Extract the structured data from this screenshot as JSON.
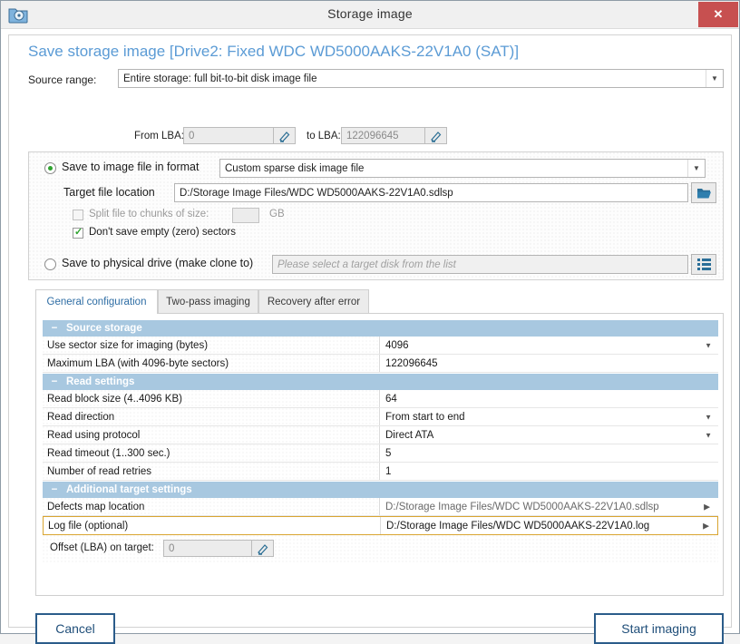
{
  "window": {
    "title": "Storage image",
    "icon": "storage-folder-icon",
    "close_label": "✕"
  },
  "page_title": "Save storage image [Drive2: Fixed WDC WD5000AAKS-22V1A0 (SAT)]",
  "source_range": {
    "label": "Source range:",
    "value": "Entire storage: full bit-to-bit disk image file",
    "from_lba_label": "From LBA:",
    "from_lba_value": "0",
    "to_lba_label": "to LBA:",
    "to_lba_value": "122096645",
    "edit_icon": "pencil-icon"
  },
  "save_options": {
    "image_file": {
      "radio_label": "Save to image file in format",
      "selected": true,
      "format_value": "Custom sparse disk image file",
      "target_label": "Target file location",
      "target_value": "D:/Storage Image Files/WDC WD5000AAKS-22V1A0.sdlsp",
      "browse_icon": "folder-open-icon",
      "split_label": "Split file to chunks of size:",
      "split_checked": false,
      "split_value": "",
      "split_unit": "GB",
      "no_empty_label": "Don't save empty (zero) sectors",
      "no_empty_checked": true
    },
    "physical_drive": {
      "radio_label": "Save to physical drive (make clone to)",
      "selected": false,
      "placeholder": "Please select a target disk from the list",
      "list_icon": "list-icon"
    }
  },
  "tabs": [
    {
      "label": "General configuration",
      "active": true
    },
    {
      "label": "Two-pass imaging",
      "active": false
    },
    {
      "label": "Recovery after error",
      "active": false
    }
  ],
  "sections": [
    {
      "title": "Source storage",
      "collapse_glyph": "−",
      "rows": [
        {
          "key": "Use sector size for imaging (bytes)",
          "value": "4096",
          "dropdown": true,
          "muted": false,
          "selected": false
        },
        {
          "key": "Maximum LBA (with 4096-byte sectors)",
          "value": "122096645",
          "dropdown": false,
          "muted": false,
          "selected": false
        }
      ]
    },
    {
      "title": "Read settings",
      "collapse_glyph": "−",
      "rows": [
        {
          "key": "Read block size (4..4096 KB)",
          "value": "64",
          "dropdown": false,
          "muted": false,
          "selected": false
        },
        {
          "key": "Read direction",
          "value": "From start to end",
          "dropdown": true,
          "muted": false,
          "selected": false
        },
        {
          "key": "Read using protocol",
          "value": "Direct ATA",
          "dropdown": true,
          "muted": false,
          "selected": false
        },
        {
          "key": "Read timeout (1..300 sec.)",
          "value": "5",
          "dropdown": false,
          "muted": false,
          "selected": false
        },
        {
          "key": "Number of read retries",
          "value": "1",
          "dropdown": false,
          "muted": false,
          "selected": false
        }
      ]
    },
    {
      "title": "Additional target settings",
      "collapse_glyph": "−",
      "rows": [
        {
          "key": "Defects map location",
          "value": "D:/Storage Image Files/WDC WD5000AAKS-22V1A0.sdlsp",
          "expand": true,
          "muted": true,
          "selected": false
        },
        {
          "key": "Log file (optional)",
          "value": "D:/Storage Image Files/WDC WD5000AAKS-22V1A0.log",
          "expand": true,
          "muted": false,
          "selected": true
        }
      ]
    }
  ],
  "offset": {
    "label": "Offset (LBA) on target:",
    "value": "0",
    "edit_icon": "pencil-icon"
  },
  "footer": {
    "cancel_label": "Cancel",
    "start_label": "Start imaging"
  },
  "colors": {
    "accent_title": "#5b9bd5",
    "section_header": "#a8c8e0",
    "button_border": "#2b5c8a",
    "button_text": "#1f4e79",
    "selected_row": "#d9a531",
    "close_button": "#c75050",
    "radio_on": "#2ea32e"
  }
}
